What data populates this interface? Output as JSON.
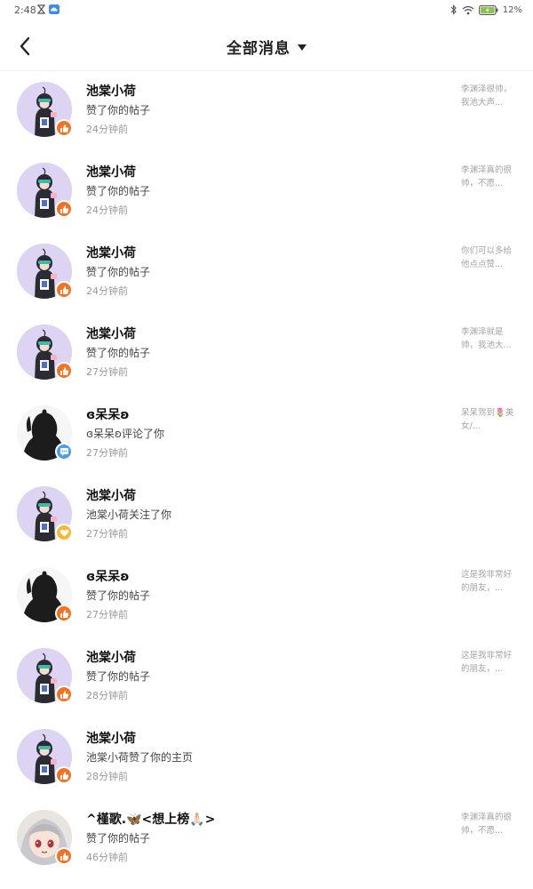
{
  "status_bar": {
    "time": "2:48",
    "battery": "12%",
    "icons": [
      "hourglass-icon",
      "cloud-app-icon",
      "bluetooth-icon",
      "wifi-icon",
      "battery-icon"
    ]
  },
  "header": {
    "title": "全部消息",
    "back_icon": "back-arrow-icon",
    "dropdown_icon": "caret-down-icon"
  },
  "colors": {
    "like_badge": "#f6721e",
    "comment_badge": "#4a9df0",
    "follow_badge": "#f7b731",
    "divider": "#eeeeee"
  },
  "messages": [
    {
      "name": "池棠小荷",
      "action": "赞了你的帖子",
      "time": "24分钟前",
      "preview": "李渊泽很帅，我池大声...",
      "avatar": "purple",
      "badge": "like-icon"
    },
    {
      "name": "池棠小荷",
      "action": "赞了你的帖子",
      "time": "24分钟前",
      "preview": "李渊泽真的很帅，不愿...",
      "avatar": "purple",
      "badge": "like-icon"
    },
    {
      "name": "池棠小荷",
      "action": "赞了你的帖子",
      "time": "24分钟前",
      "preview": "你们可以多给他点点赞...",
      "avatar": "purple",
      "badge": "like-icon"
    },
    {
      "name": "池棠小荷",
      "action": "赞了你的帖子",
      "time": "27分钟前",
      "preview": "李渊泽就是帅，我池大...",
      "avatar": "purple",
      "badge": "like-icon"
    },
    {
      "name": "ɞ呆呆ʚ",
      "action": "ɞ呆呆ʚ评论了你",
      "time": "27分钟前",
      "preview": "呆呆驾到🌷美女/...",
      "avatar": "silhouette",
      "badge": "comment-icon"
    },
    {
      "name": "池棠小荷",
      "action": "池棠小荷关注了你",
      "time": "27分钟前",
      "preview": "",
      "avatar": "purple",
      "badge": "heart-icon"
    },
    {
      "name": "ɞ呆呆ʚ",
      "action": "赞了你的帖子",
      "time": "27分钟前",
      "preview": "这是我非常好的朋友，...",
      "avatar": "silhouette",
      "badge": "like-icon"
    },
    {
      "name": "池棠小荷",
      "action": "赞了你的帖子",
      "time": "28分钟前",
      "preview": "这是我非常好的朋友，...",
      "avatar": "purple",
      "badge": "like-icon"
    },
    {
      "name": "池棠小荷",
      "action": "池棠小荷赞了你的主页",
      "time": "28分钟前",
      "preview": "",
      "avatar": "purple",
      "badge": "like-icon"
    },
    {
      "name": "^槿歌.🦋<想上榜🙏🏻>",
      "action": "赞了你的帖子",
      "time": "46分钟前",
      "preview": "李渊泽真的很帅，不愿...",
      "avatar": "anime",
      "badge": "like-icon"
    }
  ]
}
